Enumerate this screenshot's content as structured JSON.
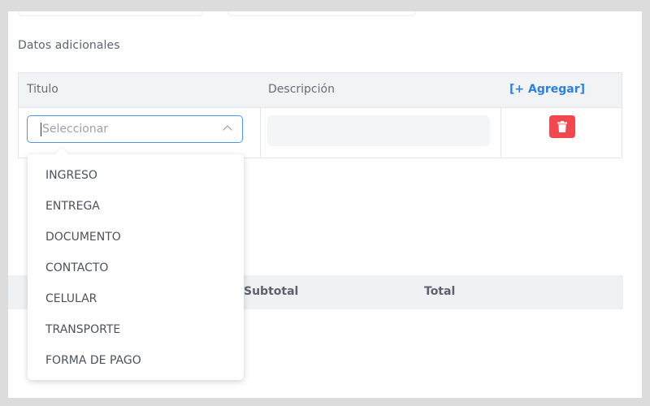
{
  "section": {
    "title": "Datos adicionales"
  },
  "table": {
    "headers": {
      "titulo": "Titulo",
      "descripcion": "Descripción",
      "add": "[+ Agregar]"
    },
    "row": {
      "select_placeholder": "Seleccionar",
      "description_value": ""
    }
  },
  "dropdown": {
    "options": [
      "INGRESO",
      "ENTREGA",
      "DOCUMENTO",
      "CONTACTO",
      "CELULAR",
      "TRANSPORTE",
      "FORMA DE PAGO"
    ]
  },
  "totals": {
    "subtotal_label": "Subtotal",
    "total_label": "Total"
  },
  "colors": {
    "accent": "#2f7fe0",
    "focus_border": "#4f97e6",
    "danger": "#f0484e",
    "header_bg": "#f2f3f5"
  },
  "icons": {
    "delete": "trash-icon",
    "select_toggle": "chevron-up-icon"
  }
}
